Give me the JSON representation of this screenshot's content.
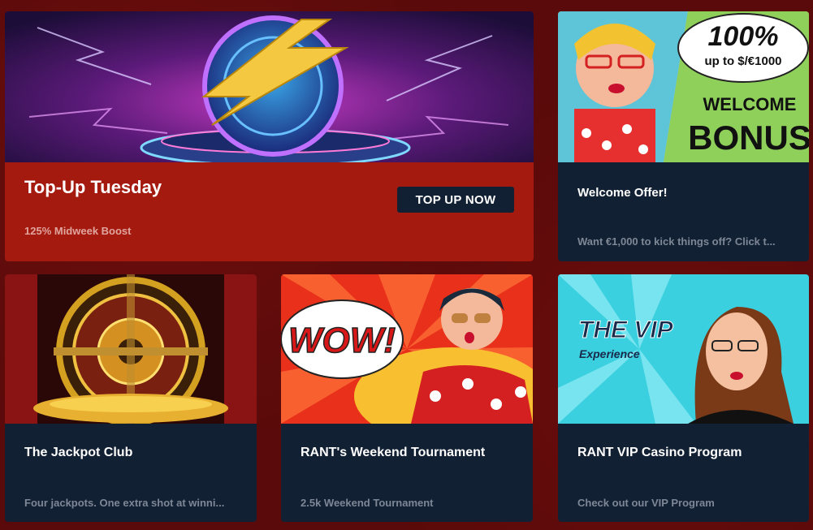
{
  "promos": [
    {
      "title": "Top-Up Tuesday",
      "subtitle": "125% Midweek Boost",
      "cta_label": "TOP UP NOW",
      "image_icon": "lightning-coin-icon"
    },
    {
      "title": "Welcome Offer!",
      "subtitle": "Want €1,000 to kick things off? Click t...",
      "image_icon": "welcome-bonus-banner",
      "banner_line1": "100%",
      "banner_line2": "up to $/€1000",
      "banner_line3": "WELCOME",
      "banner_line4": "BONUS"
    },
    {
      "title": "The Jackpot Club",
      "subtitle": "Four jackpots. One extra shot at winni...",
      "image_icon": "roulette-vault-icon"
    },
    {
      "title": "RANT's Weekend Tournament",
      "subtitle": "2.5k Weekend Tournament",
      "image_icon": "wow-comic-banner",
      "banner_text": "WOW!"
    },
    {
      "title": "RANT VIP Casino Program",
      "subtitle": "Check out our VIP Program",
      "image_icon": "vip-comic-banner",
      "banner_line1": "THE VIP",
      "banner_line2": "Experience"
    }
  ],
  "colors": {
    "page_bg": "#5a0a0a",
    "card_bg": "#122033",
    "featured_bg": "#a51a0f",
    "subtitle": "#7d8796"
  }
}
